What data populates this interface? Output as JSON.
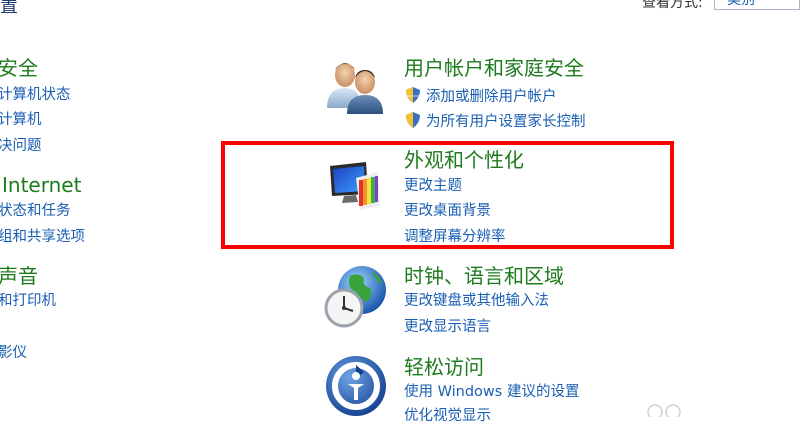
{
  "header": {
    "title_char": "置",
    "view_by_label": "查看方式:",
    "view_by_value": "类别"
  },
  "left_column": [
    {
      "title": "安全",
      "links": [
        "计算机状态",
        "计算机",
        "决问题"
      ]
    },
    {
      "title": "Internet",
      "links": [
        "状态和任务",
        "组和共享选项"
      ]
    },
    {
      "title": "声音",
      "links": [
        "和打印机",
        "影仪"
      ]
    }
  ],
  "categories": [
    {
      "title": "用户帐户和家庭安全",
      "icon": "users-icon",
      "links": [
        "添加或删除用户帐户",
        "为所有用户设置家长控制"
      ]
    },
    {
      "title": "外观和个性化",
      "icon": "monitor-palette-icon",
      "links": [
        "更改主题",
        "更改桌面背景",
        "调整屏幕分辨率"
      ]
    },
    {
      "title": "时钟、语言和区域",
      "icon": "globe-clock-icon",
      "links": [
        "更改键盘或其他输入法",
        "更改显示语言"
      ]
    },
    {
      "title": "轻松访问",
      "icon": "ease-of-access-icon",
      "links": [
        "使用 Windows 建议的设置",
        "优化视觉显示"
      ]
    }
  ],
  "colors": {
    "title_green": "#1e7b1e",
    "link_blue": "#1a5fb4",
    "highlight_red": "#ff0000"
  }
}
